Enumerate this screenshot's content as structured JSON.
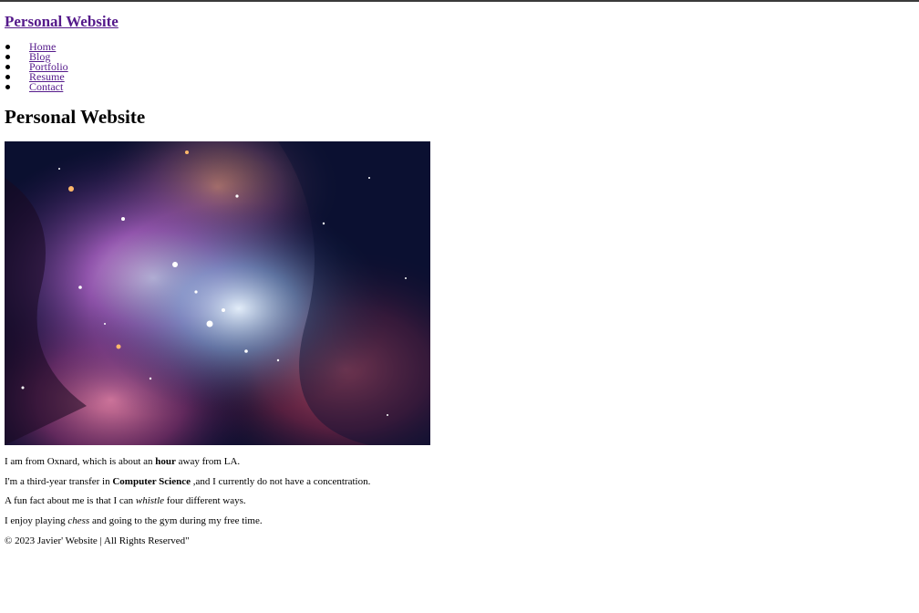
{
  "header": {
    "site_link": "Personal Website"
  },
  "nav": {
    "items": [
      {
        "label": "Home"
      },
      {
        "label": "Blog"
      },
      {
        "label": "Portfolio"
      },
      {
        "label": "Resume"
      },
      {
        "label": "Contact"
      }
    ]
  },
  "main": {
    "title": "Personal Website",
    "image": {
      "icon": "nebula-image"
    },
    "paragraphs": {
      "p1": {
        "a": "I am from Oxnard, which is about an ",
        "bold": "hour",
        "b": " away from LA."
      },
      "p2": {
        "a": "I'm a third-year transfer in ",
        "bold": "Computer Science",
        "b": " ,and I currently do not have a concentration."
      },
      "p3": {
        "a": "A fun fact about me is that I can ",
        "italic": "whistle",
        "b": " four different ways."
      },
      "p4": {
        "a": "I enjoy playing ",
        "italic": "chess",
        "b": " and going to the gym during my free time."
      }
    },
    "footer": "© 2023 Javier' Website | All Rights Reserved\""
  },
  "colors": {
    "link_visited": "#551a8b",
    "text": "#000000",
    "background": "#ffffff"
  }
}
